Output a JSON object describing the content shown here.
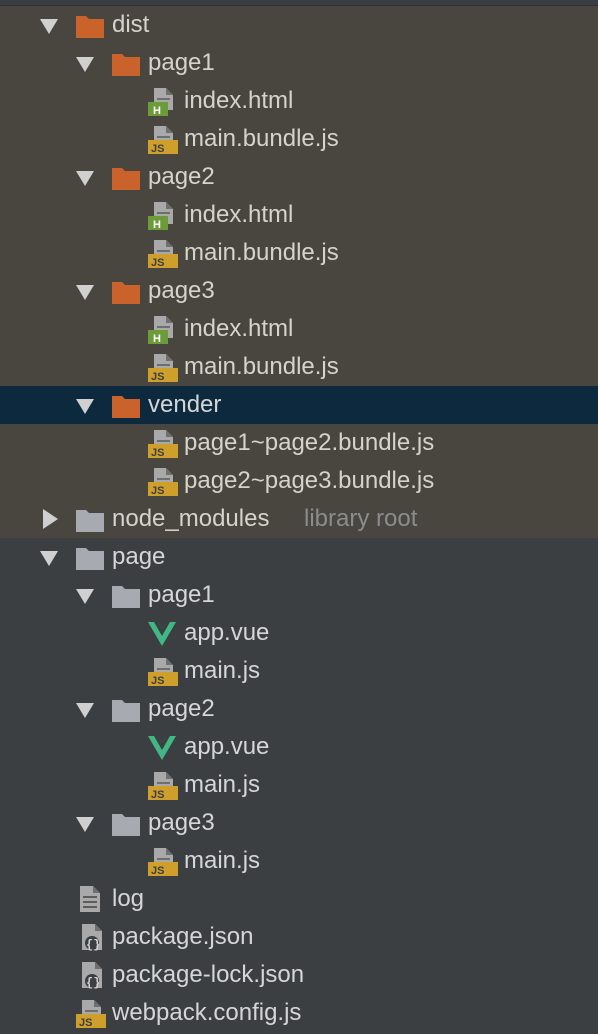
{
  "colors": {
    "excluded_bg": "#48463f",
    "normal_bg": "#3c3f41",
    "selected_bg": "#0d293e",
    "excluded_folder": "#c9622b",
    "normal_folder": "#a7aab0",
    "html_badge": "#6c9b3a",
    "js_badge": "#cf9f2c",
    "vue_green": "#41b883",
    "vue_dark": "#2fa070"
  },
  "tree": {
    "items": [
      {
        "label": "dist",
        "icon": "folder-icon",
        "expanded": true
      },
      {
        "label": "page1",
        "icon": "folder-icon",
        "expanded": true
      },
      {
        "label": "index.html",
        "icon": "html-file-icon"
      },
      {
        "label": "main.bundle.js",
        "icon": "js-file-icon"
      },
      {
        "label": "page2",
        "icon": "folder-icon",
        "expanded": true
      },
      {
        "label": "index.html",
        "icon": "html-file-icon"
      },
      {
        "label": "main.bundle.js",
        "icon": "js-file-icon"
      },
      {
        "label": "page3",
        "icon": "folder-icon",
        "expanded": true
      },
      {
        "label": "index.html",
        "icon": "html-file-icon"
      },
      {
        "label": "main.bundle.js",
        "icon": "js-file-icon"
      },
      {
        "label": "vender",
        "icon": "folder-icon",
        "expanded": true,
        "selected": true
      },
      {
        "label": "page1~page2.bundle.js",
        "icon": "js-file-icon"
      },
      {
        "label": "page2~page3.bundle.js",
        "icon": "js-file-icon"
      },
      {
        "label": "node_modules",
        "hint": "library root",
        "icon": "folder-icon",
        "expanded": false
      },
      {
        "label": "page",
        "icon": "folder-icon",
        "expanded": true
      },
      {
        "label": "page1",
        "icon": "folder-icon",
        "expanded": true
      },
      {
        "label": "app.vue",
        "icon": "vue-file-icon"
      },
      {
        "label": "main.js",
        "icon": "js-file-icon"
      },
      {
        "label": "page2",
        "icon": "folder-icon",
        "expanded": true
      },
      {
        "label": "app.vue",
        "icon": "vue-file-icon"
      },
      {
        "label": "main.js",
        "icon": "js-file-icon"
      },
      {
        "label": "page3",
        "icon": "folder-icon",
        "expanded": true
      },
      {
        "label": "main.js",
        "icon": "js-file-icon"
      },
      {
        "label": "log",
        "icon": "text-file-icon"
      },
      {
        "label": "package.json",
        "icon": "json-file-icon"
      },
      {
        "label": "package-lock.json",
        "icon": "json-file-icon"
      },
      {
        "label": "webpack.config.js",
        "icon": "js-file-icon"
      }
    ]
  }
}
